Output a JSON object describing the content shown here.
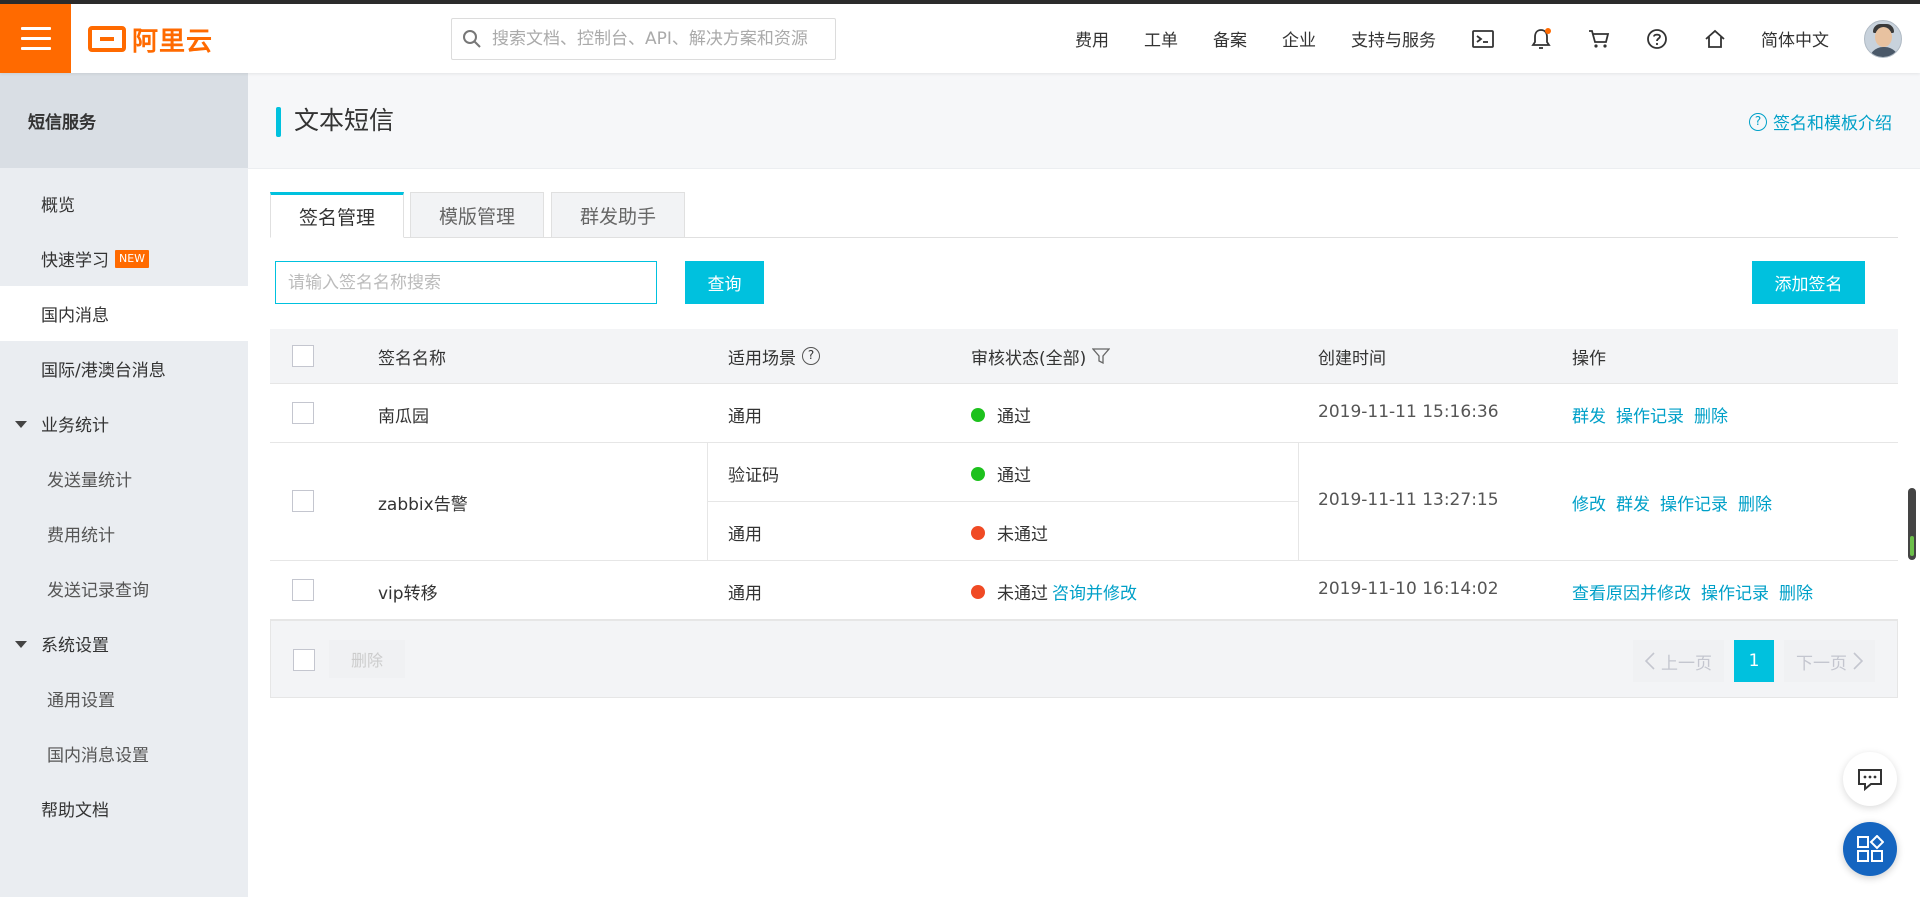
{
  "topbar": {
    "logo_text": "阿里云",
    "search_placeholder": "搜索文档、控制台、API、解决方案和资源",
    "nav": [
      "费用",
      "工单",
      "备案",
      "企业",
      "支持与服务"
    ],
    "language": "简体中文"
  },
  "sidebar": {
    "title": "短信服务",
    "items": [
      {
        "label": "概览"
      },
      {
        "label": "快速学习",
        "badge": "NEW"
      },
      {
        "label": "国内消息"
      },
      {
        "label": "国际/港澳台消息"
      },
      {
        "label": "业务统计"
      },
      {
        "label": "发送量统计"
      },
      {
        "label": "费用统计"
      },
      {
        "label": "发送记录查询"
      },
      {
        "label": "系统设置"
      },
      {
        "label": "通用设置"
      },
      {
        "label": "国内消息设置"
      },
      {
        "label": "帮助文档"
      }
    ],
    "active": "国内消息"
  },
  "page": {
    "title": "文本短信",
    "help_link": "签名和模板介绍",
    "tabs": [
      "签名管理",
      "模版管理",
      "群发助手"
    ],
    "active_tab": "签名管理",
    "filter_placeholder": "请输入签名名称搜索",
    "query_button": "查询",
    "add_button": "添加签名"
  },
  "table": {
    "headers": {
      "name": "签名名称",
      "scene": "适用场景",
      "status": "审核状态(全部)",
      "created": "创建时间",
      "actions": "操作"
    },
    "rows": [
      {
        "name": "南瓜园",
        "scenes": [
          {
            "scene": "通用",
            "status": "通过",
            "status_color": "#1dc11d"
          }
        ],
        "created": "2019-11-11 15:16:36",
        "actions": [
          "群发",
          "操作记录",
          "删除"
        ]
      },
      {
        "name": "zabbix告警",
        "scenes": [
          {
            "scene": "验证码",
            "status": "通过",
            "status_color": "#1dc11d"
          },
          {
            "scene": "通用",
            "status": "未通过",
            "status_color": "#f04a24"
          }
        ],
        "created": "2019-11-11 13:27:15",
        "actions": [
          "修改",
          "群发",
          "操作记录",
          "删除"
        ]
      },
      {
        "name": "vip转移",
        "scenes": [
          {
            "scene": "通用",
            "status": "未通过",
            "status_color": "#f04a24",
            "extra_link": "咨询并修改"
          }
        ],
        "created": "2019-11-10 16:14:02",
        "actions": [
          "查看原因并修改",
          "操作记录",
          "删除"
        ]
      }
    ]
  },
  "footer": {
    "delete_button": "删除",
    "prev": "上一页",
    "next": "下一页",
    "page": "1"
  },
  "colors": {
    "brand": "#ff6a00",
    "accent": "#00c1de",
    "link": "#00a0c8",
    "ok": "#1dc11d",
    "fail": "#f04a24"
  }
}
